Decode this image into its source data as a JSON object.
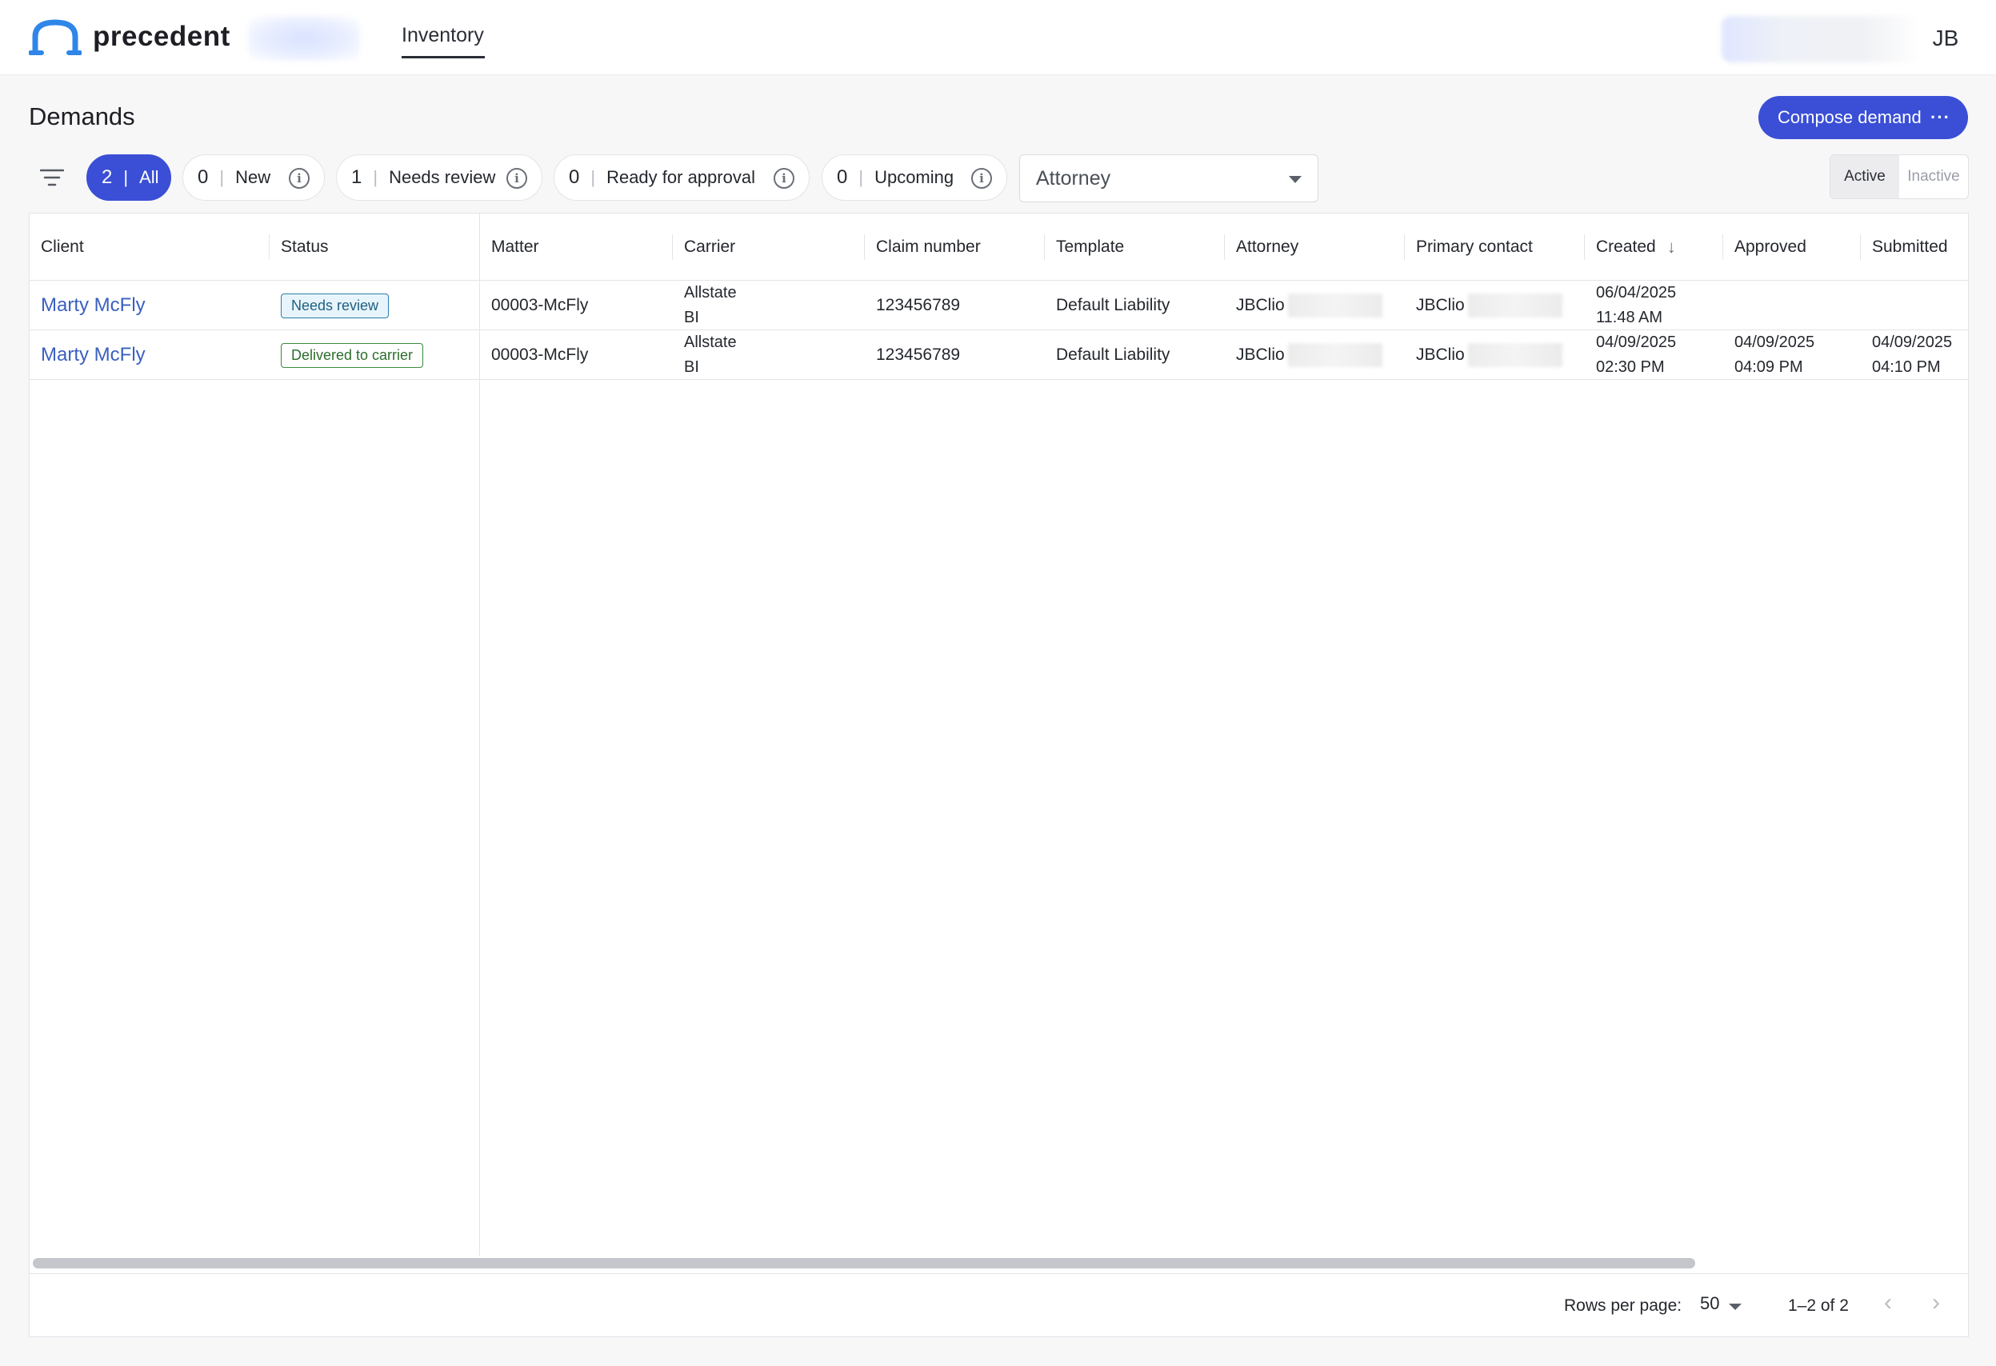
{
  "app": {
    "brand": "precedent",
    "nav_tab": "Inventory",
    "user_initials": "JB",
    "brand_color": "#3a4fd6"
  },
  "page": {
    "title": "Demands",
    "compose_label": "Compose demand",
    "compose_more": "···"
  },
  "filters": {
    "chips": [
      {
        "count": "2",
        "label": "All",
        "active": true
      },
      {
        "count": "0",
        "label": "New",
        "info": true
      },
      {
        "count": "1",
        "label": "Needs review",
        "info": true
      },
      {
        "count": "0",
        "label": "Ready for approval",
        "info": true
      },
      {
        "count": "0",
        "label": "Upcoming",
        "info": true
      }
    ],
    "info_glyph": "i",
    "attorney_placeholder": "Attorney",
    "toggle": {
      "active": "Active",
      "inactive": "Inactive",
      "selected": "Active"
    }
  },
  "table": {
    "columns": [
      "Client",
      "Status",
      "Matter",
      "Carrier",
      "Claim number",
      "Template",
      "Attorney",
      "Primary contact",
      "Created",
      "Approved",
      "Submitted"
    ],
    "sort_indicator": "↓",
    "rows": [
      {
        "client": "Marty McFly",
        "status": "Needs review",
        "matter": "00003-McFly",
        "carrier_1": "Allstate",
        "carrier_2": "BI",
        "claim": "123456789",
        "template": "Default Liability",
        "attorney": "JBClio",
        "contact": "JBClio",
        "created_date": "06/04/2025",
        "created_time": "11:48 AM",
        "approved_date": "",
        "approved_time": "",
        "submitted_date": "",
        "submitted_time": ""
      },
      {
        "client": "Marty McFly",
        "status": "Delivered to carrier",
        "matter": "00003-McFly",
        "carrier_1": "Allstate",
        "carrier_2": "BI",
        "claim": "123456789",
        "template": "Default Liability",
        "attorney": "JBClio",
        "contact": "JBClio",
        "created_date": "04/09/2025",
        "created_time": "02:30 PM",
        "approved_date": "04/09/2025",
        "approved_time": "04:09 PM",
        "submitted_date": "04/09/2025",
        "submitted_time": "04:10 PM"
      }
    ]
  },
  "footer": {
    "rows_per_page_label": "Rows per page:",
    "rows_per_page_value": "50",
    "range": "1–2 of 2",
    "prev_glyph": "‹",
    "next_glyph": "›"
  }
}
